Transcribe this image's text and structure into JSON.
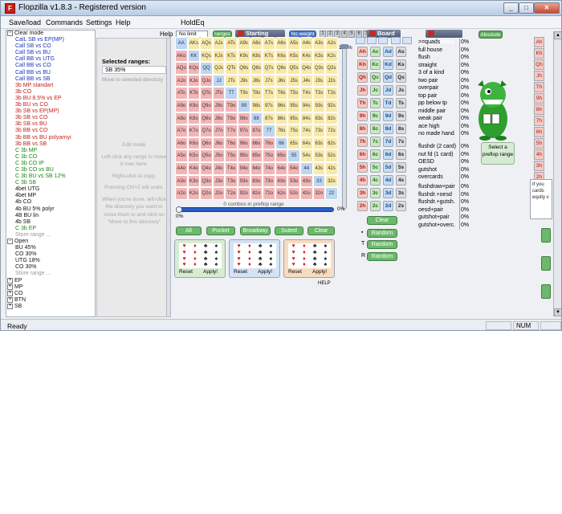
{
  "window": {
    "app_icon_letter": "F",
    "title": "Flopzilla v1.8.3 - Registered version",
    "controls": [
      "_",
      "□",
      "✕"
    ]
  },
  "menu": [
    "Save/load",
    "Commands",
    "Settings",
    "Help",
    "HoldEq"
  ],
  "help_link": "Help",
  "left_list": {
    "clear_mode": "Clear mode",
    "items": [
      {
        "text": "CalL SB vs EP(MP)",
        "color": "blue"
      },
      {
        "text": "Call SB vs CO",
        "color": "blue"
      },
      {
        "text": "Call SB vs BU",
        "color": "blue"
      },
      {
        "text": "Call BB vs UTG",
        "color": "blue"
      },
      {
        "text": "Call BB vs CO",
        "color": "blue"
      },
      {
        "text": "Call BB vs BU",
        "color": "blue"
      },
      {
        "text": "Call BB vs SB",
        "color": "blue"
      },
      {
        "text": "3b MP standart",
        "color": "red"
      },
      {
        "text": "3b CO",
        "color": "red"
      },
      {
        "text": "3b BU 8.5% vs EP",
        "color": "red"
      },
      {
        "text": "3b BU vs CO",
        "color": "red"
      },
      {
        "text": "3b SB vs EP(MP)",
        "color": "red"
      },
      {
        "text": "3b SB vs CO",
        "color": "red"
      },
      {
        "text": "3b SB vs BU",
        "color": "red"
      },
      {
        "text": "3b BB vs CO",
        "color": "red"
      },
      {
        "text": "3b BB vs BU polyarnyi",
        "color": "red"
      },
      {
        "text": "3b BB vs SB",
        "color": "red"
      },
      {
        "text": "C 3b MP",
        "color": "green"
      },
      {
        "text": "C 3b CO",
        "color": "green"
      },
      {
        "text": "C 3b CO IP",
        "color": "green"
      },
      {
        "text": "C 3b CO vs BU",
        "color": "green"
      },
      {
        "text": "C 3b BU vs SB 12%",
        "color": "green"
      },
      {
        "text": "C 3b SB",
        "color": "green"
      },
      {
        "text": "4bet UTG",
        "color": "black"
      },
      {
        "text": "4bet MP",
        "color": "black"
      },
      {
        "text": "4b CO",
        "color": "black"
      },
      {
        "text": "4b BU 5% polyr",
        "color": "black"
      },
      {
        "text": "4B BU lin",
        "color": "black"
      },
      {
        "text": "4b SB",
        "color": "black"
      },
      {
        "text": "C 3b EP",
        "color": "green"
      },
      {
        "text": "Store range ...",
        "color": "grey"
      }
    ],
    "open_folder": "Open",
    "open_items": [
      {
        "text": "BU 45%",
        "color": "black"
      },
      {
        "text": "CO 30%",
        "color": "black"
      },
      {
        "text": "UTG 18%",
        "color": "black"
      },
      {
        "text": "CO 30%",
        "color": "black"
      },
      {
        "text": "Store range ...",
        "color": "grey"
      }
    ],
    "folders": [
      "EP",
      "MP",
      "CO",
      "BTN",
      "SB"
    ]
  },
  "mid_panel": {
    "selected_label": "Selected ranges:",
    "selected_value": "SB 35%",
    "move_link": "Move to selected directory",
    "edit_title": "Edit mode",
    "edit_lines": [
      "Left-click any range to move it over here.",
      "Right-click to copy.",
      "Pressing Ctrl+Z will undo.",
      "When you're done, left-click the directory you want to move them to and click on \"Move to this directory\""
    ]
  },
  "toolbar": {
    "limit_select": "No limit",
    "ranges_btn": "ranges",
    "starting_hand": "Starting hand",
    "no_weight_btn": "No weight",
    "small_btns": [
      "1",
      "2",
      "3",
      "4",
      "5",
      "6",
      "7"
    ],
    "board_title": "Board",
    "stats_title": "Statistics",
    "absolute_btn": "Absolute"
  },
  "grid": {
    "ranks": [
      "A",
      "K",
      "Q",
      "J",
      "T",
      "9",
      "8",
      "7",
      "6",
      "5",
      "4",
      "3",
      "2"
    ],
    "vertical_pct": "100%",
    "vertical_bottom": "0%",
    "combos_text": "0 combos in preflop range",
    "h_left": "0%",
    "h_right": "0%"
  },
  "quick_buttons": [
    "All",
    "Pocket",
    "Broadway",
    "Suited",
    "Clear"
  ],
  "suit_boxes": [
    {
      "reset": "Reset",
      "apply": "Apply!"
    },
    {
      "reset": "Reset",
      "apply": "Apply!"
    },
    {
      "reset": "Reset",
      "apply": "Apply!"
    }
  ],
  "help_small": "HELP",
  "board": {
    "cards": [
      [
        "Ah",
        "Ac",
        "Ad",
        "As"
      ],
      [
        "Kh",
        "Kc",
        "Kd",
        "Ks"
      ],
      [
        "Qh",
        "Qc",
        "Qd",
        "Qs"
      ],
      [
        "Jh",
        "Jc",
        "Jd",
        "Js"
      ],
      [
        "Th",
        "Tc",
        "Td",
        "Ts"
      ],
      [
        "9h",
        "9c",
        "9d",
        "9s"
      ],
      [
        "8h",
        "8c",
        "8d",
        "8s"
      ],
      [
        "7h",
        "7c",
        "7d",
        "7s"
      ],
      [
        "6h",
        "6c",
        "6d",
        "6s"
      ],
      [
        "5h",
        "5c",
        "5d",
        "5s"
      ],
      [
        "4h",
        "4c",
        "4d",
        "4s"
      ],
      [
        "3h",
        "3c",
        "3d",
        "3s"
      ],
      [
        "2h",
        "2c",
        "2d",
        "2s"
      ]
    ],
    "buttons": [
      "Clear",
      "Random",
      "Random",
      "Random"
    ]
  },
  "stats": {
    "rows": [
      [
        ">=quads",
        "0%"
      ],
      [
        "full house",
        "0%"
      ],
      [
        "flush",
        "0%"
      ],
      [
        "straight",
        "0%"
      ],
      [
        "3 of a kind",
        "0%"
      ],
      [
        "two pair",
        "0%"
      ],
      [
        "overpair",
        "0%"
      ],
      [
        "top pair",
        "0%"
      ],
      [
        "pp below tp",
        "0%"
      ],
      [
        "middle pair",
        "0%"
      ],
      [
        "weak pair",
        "0%"
      ],
      [
        "ace high",
        "0%"
      ],
      [
        "no made hand",
        "0%"
      ],
      [
        "flushdr (2 card)",
        "0%"
      ],
      [
        "nut fd (1 card)",
        "0%"
      ],
      [
        "OESD",
        "0%"
      ],
      [
        "gutshot",
        "0%"
      ],
      [
        "overcards",
        "0%"
      ],
      [
        "flushdraw+pair",
        "0%"
      ],
      [
        "flushdr.+oesd",
        "0%"
      ],
      [
        "flushdr.+gutsh.",
        "0%"
      ],
      [
        "oesd+pair",
        "0%"
      ],
      [
        "gutshot+pair",
        "0%"
      ],
      [
        "gutshot+overc.",
        "0%"
      ]
    ]
  },
  "select_preflop": "Select a preflop range",
  "right_col": [
    "Ah",
    "Kh",
    "Qh",
    "Jh",
    "Th",
    "9h",
    "8h",
    "7h",
    "6h",
    "5h",
    "4h",
    "3h",
    "2h"
  ],
  "popup_text": "If you cards equity v",
  "status": {
    "left": "Ready",
    "num": "NUM"
  },
  "colors": {
    "suited": "#f8e9a9",
    "offsuit": "#f2b5b5",
    "pair": "#bcd6f4",
    "accent_green": "#6cb86c",
    "accent_blue": "#4b72c8"
  }
}
